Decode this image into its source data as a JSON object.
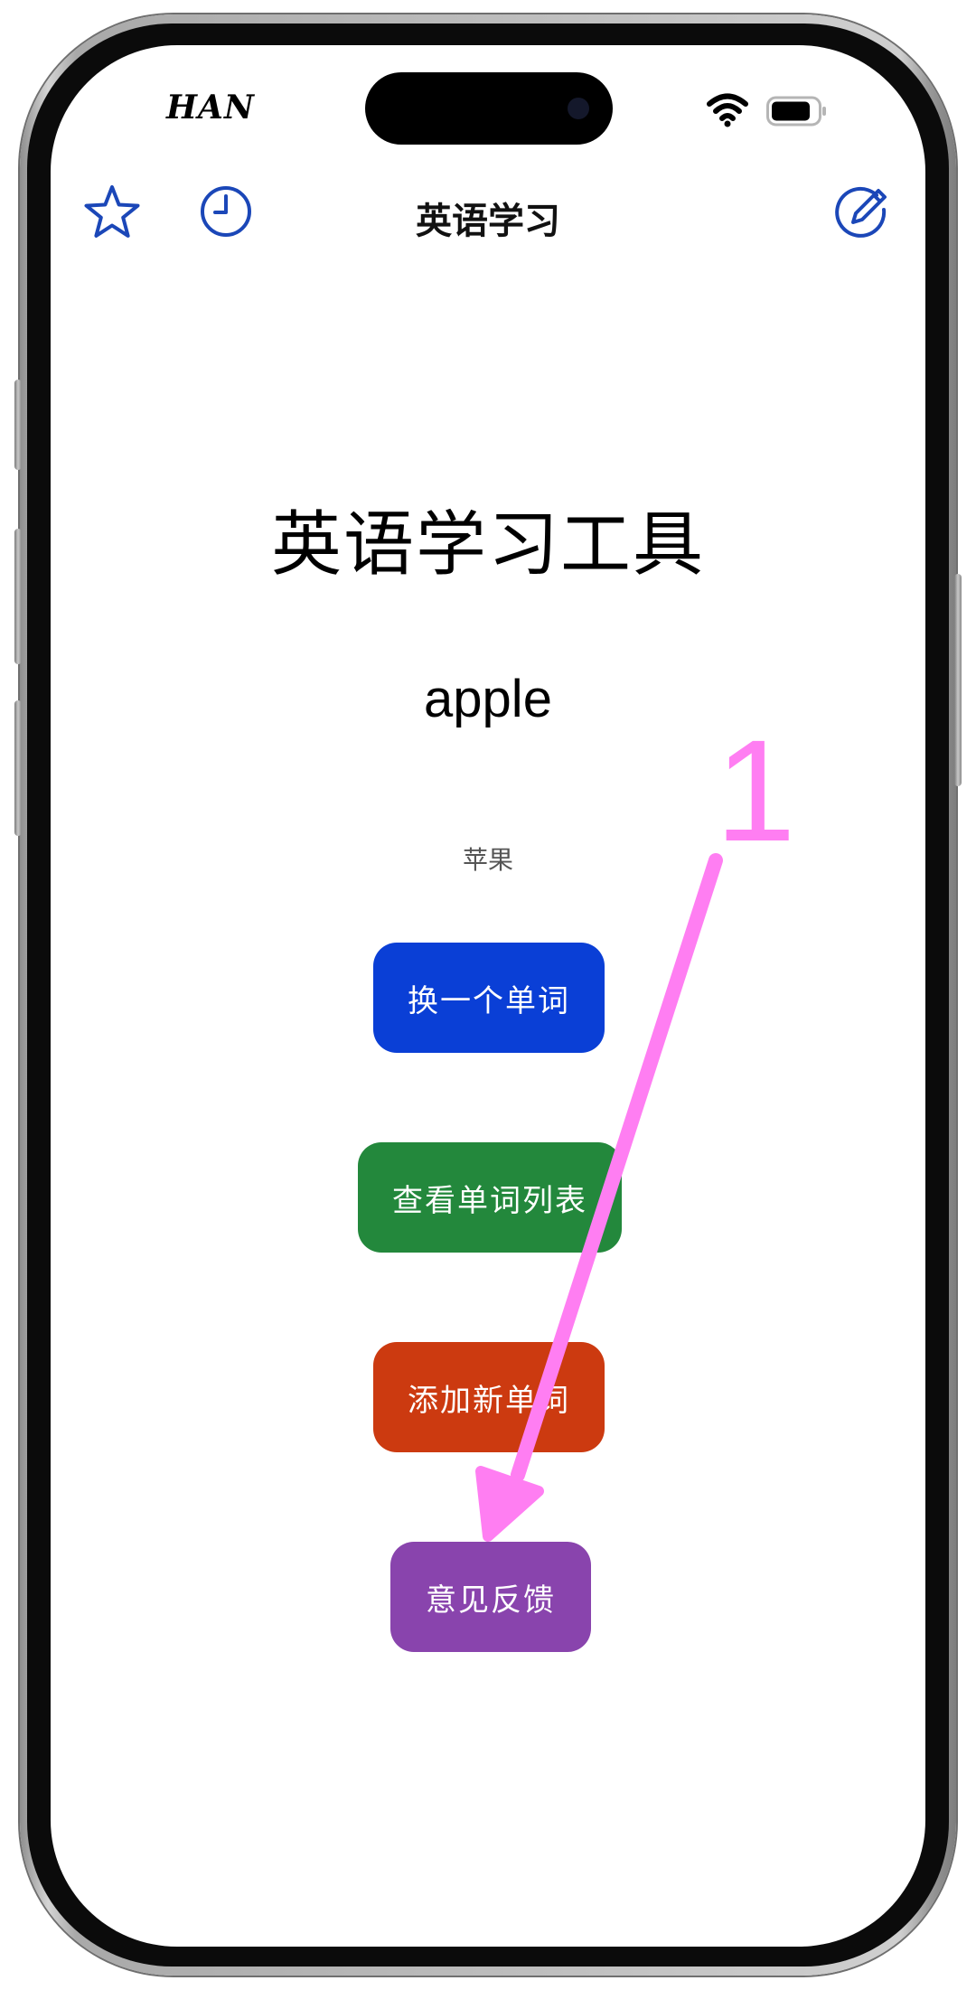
{
  "status_bar": {
    "carrier": "HAN"
  },
  "nav": {
    "title": "英语学习",
    "icons": [
      "star-icon",
      "clock-icon",
      "compose-icon"
    ]
  },
  "main": {
    "title": "英语学习工具",
    "word": "apple",
    "meaning": "苹果"
  },
  "buttons": {
    "change_word": "换一个单词",
    "view_list": "查看单词列表",
    "add_word": "添加新单词",
    "feedback": "意见反馈"
  },
  "colors": {
    "nav_icon": "#1b47b8",
    "change_word_button": "#0a3fd6",
    "view_list_button": "#23883c",
    "add_word_button": "#cc3a10",
    "feedback_button": "#8944ad",
    "annotation": "#ff7ef2"
  },
  "annotation": {
    "step_label": "1"
  }
}
